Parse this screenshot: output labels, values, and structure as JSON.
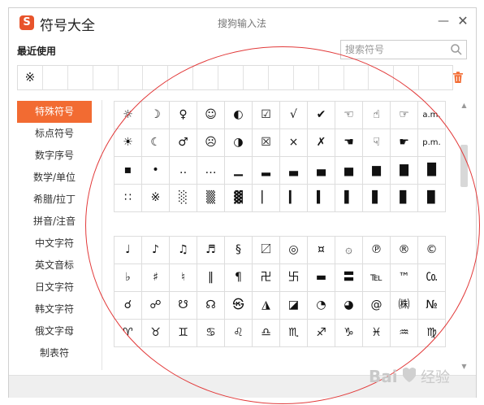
{
  "titlebar": {
    "app_title": "符号大全",
    "ime_title": "搜狗输入法",
    "logo_letter": "S",
    "min_label": "—",
    "close_label": "✕"
  },
  "recent": {
    "label": "最近使用",
    "items": [
      "※",
      "",
      "",
      "",
      "",
      "",
      "",
      "",
      "",
      "",
      "",
      "",
      "",
      "",
      "",
      "",
      ""
    ]
  },
  "search": {
    "placeholder": "搜索符号"
  },
  "sidebar": {
    "items": [
      {
        "label": "特殊符号",
        "active": true
      },
      {
        "label": "标点符号",
        "active": false
      },
      {
        "label": "数字序号",
        "active": false
      },
      {
        "label": "数学/单位",
        "active": false
      },
      {
        "label": "希腊/拉丁",
        "active": false
      },
      {
        "label": "拼音/注音",
        "active": false
      },
      {
        "label": "中文字符",
        "active": false
      },
      {
        "label": "英文音标",
        "active": false
      },
      {
        "label": "日文字符",
        "active": false
      },
      {
        "label": "韩文字符",
        "active": false
      },
      {
        "label": "俄文字母",
        "active": false
      },
      {
        "label": "制表符",
        "active": false
      }
    ]
  },
  "symbols_group1": [
    [
      "☼",
      "☽",
      "♀",
      "☺",
      "◐",
      "☑",
      "√",
      "✔",
      "☜",
      "☝",
      "☞",
      "a.m."
    ],
    [
      "☀",
      "☾",
      "♂",
      "☹",
      "◑",
      "☒",
      "×",
      "✗",
      "☚",
      "☟",
      "☛",
      "p.m."
    ],
    [
      "▪",
      "•",
      "‥",
      "…",
      "▁",
      "▂",
      "▃",
      "▄",
      "▅",
      "▆",
      "▇",
      "█"
    ],
    [
      "∷",
      "※",
      "░",
      "▒",
      "▓",
      "▏",
      "▎",
      "▍",
      "▌",
      "▋",
      "▊",
      "▉"
    ]
  ],
  "symbols_group2": [
    [
      "♩",
      "♪",
      "♫",
      "♬",
      "§",
      "〼",
      "◎",
      "¤",
      "۞",
      "℗",
      "®",
      "©"
    ],
    [
      "♭",
      "♯",
      "♮",
      "‖",
      "¶",
      "卍",
      "卐",
      "▬",
      "〓",
      "℡",
      "™",
      "㏇"
    ],
    [
      "☌",
      "☍",
      "☋",
      "☊",
      "㉿",
      "◮",
      "◪",
      "◔",
      "◕",
      "@",
      "㈱",
      "№"
    ],
    [
      "♈",
      "♉",
      "♊",
      "♋",
      "♌",
      "♎",
      "♏",
      "♐",
      "♑",
      "♓",
      "♒",
      "♍"
    ]
  ],
  "colors": {
    "accent": "#f26b32",
    "logo": "#e8542b",
    "annotation": "#e23a3a"
  },
  "watermark": {
    "text": "Bai 经验"
  }
}
